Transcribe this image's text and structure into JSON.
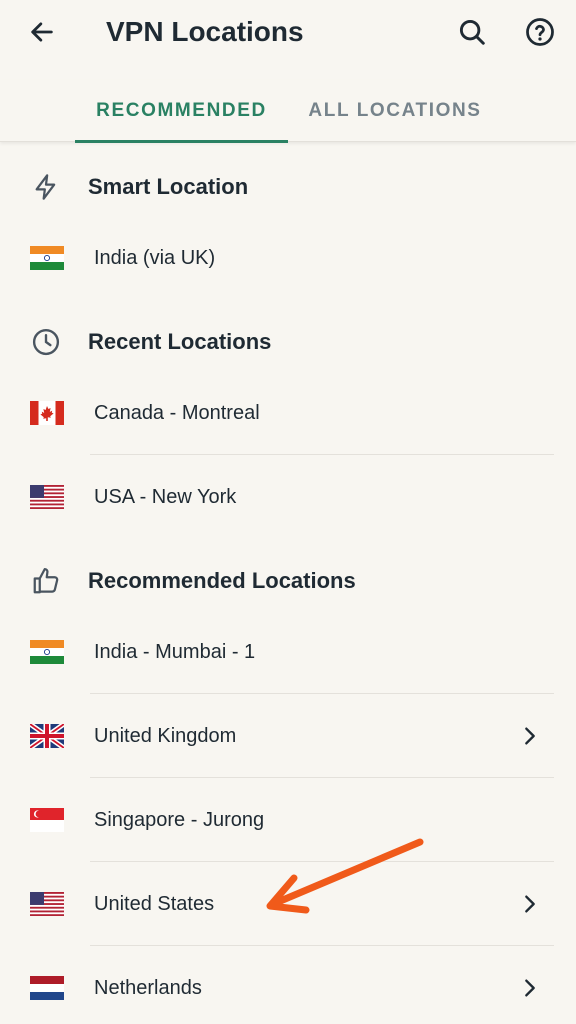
{
  "appbar": {
    "title": "VPN Locations",
    "back_icon": "arrow-left-icon",
    "search_icon": "search-icon",
    "help_icon": "help-circle-icon"
  },
  "tabs": [
    {
      "label": "RECOMMENDED",
      "selected": true
    },
    {
      "label": "ALL LOCATIONS",
      "selected": false
    }
  ],
  "sections": {
    "smart": {
      "title": "Smart Location",
      "icon": "lightning-icon"
    },
    "recent": {
      "title": "Recent Locations",
      "icon": "clock-icon"
    },
    "recommended": {
      "title": "Recommended Locations",
      "icon": "thumbs-up-icon"
    }
  },
  "locations": {
    "smart": [
      {
        "label": "India (via UK)",
        "flag": "india-flag-icon",
        "has_chevron": false
      }
    ],
    "recent": [
      {
        "label": "Canada - Montreal",
        "flag": "canada-flag-icon",
        "has_chevron": false
      },
      {
        "label": "USA - New York",
        "flag": "usa-flag-icon",
        "has_chevron": false
      }
    ],
    "recommended": [
      {
        "label": "India - Mumbai - 1",
        "flag": "india-flag-icon",
        "has_chevron": false
      },
      {
        "label": "United Kingdom",
        "flag": "uk-flag-icon",
        "has_chevron": true
      },
      {
        "label": "Singapore - Jurong",
        "flag": "singapore-flag-icon",
        "has_chevron": false
      },
      {
        "label": "United States",
        "flag": "usa-flag-icon",
        "has_chevron": true
      },
      {
        "label": "Netherlands",
        "flag": "netherlands-flag-icon",
        "has_chevron": true
      }
    ]
  },
  "colors": {
    "accent": "#2a8163",
    "background": "#f8f6f1",
    "annotation_arrow": "#f05a1a"
  }
}
